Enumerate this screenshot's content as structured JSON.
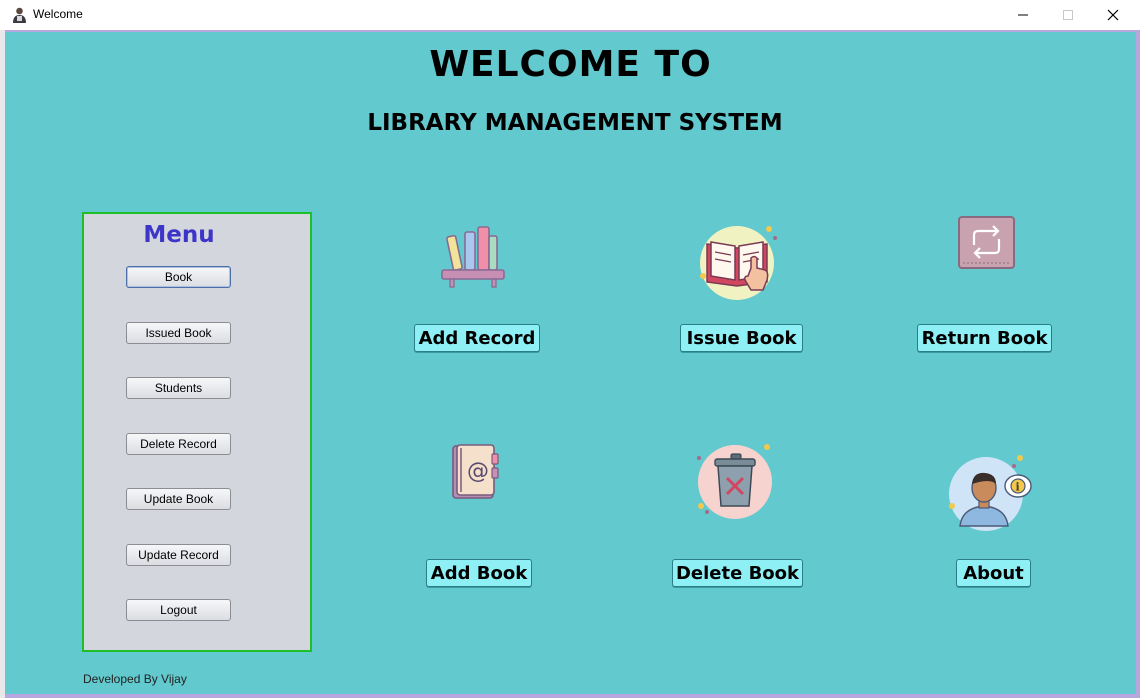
{
  "window": {
    "title": "Welcome",
    "minimize_glyph": "—",
    "maximize_glyph": "☐",
    "close_glyph": "✕"
  },
  "header": {
    "title": "WELCOME TO",
    "subtitle": "LIBRARY MANAGEMENT SYSTEM"
  },
  "menu": {
    "title": "Menu",
    "items": [
      {
        "label": "Book"
      },
      {
        "label": "Issued Book"
      },
      {
        "label": "Students"
      },
      {
        "label": "Delete Record"
      },
      {
        "label": "Update Book"
      },
      {
        "label": "Update Record"
      },
      {
        "label": "Logout"
      }
    ]
  },
  "actions": [
    {
      "label": "Add Record",
      "icon": "bookshelf-icon"
    },
    {
      "label": "Issue Book",
      "icon": "open-book-hand-icon"
    },
    {
      "label": "Return Book",
      "icon": "return-arrows-icon"
    },
    {
      "label": "Add Book",
      "icon": "address-book-icon"
    },
    {
      "label": "Delete Book",
      "icon": "trash-can-icon"
    },
    {
      "label": "About",
      "icon": "user-info-icon"
    }
  ],
  "footer": {
    "credit": "Developed By Vijay"
  },
  "colors": {
    "background": "#62c9ce",
    "menu_panel": "#d4d6de",
    "menu_border": "#1fbf2a",
    "menu_title": "#3d35c8",
    "action_button": "#8ef0f4"
  }
}
